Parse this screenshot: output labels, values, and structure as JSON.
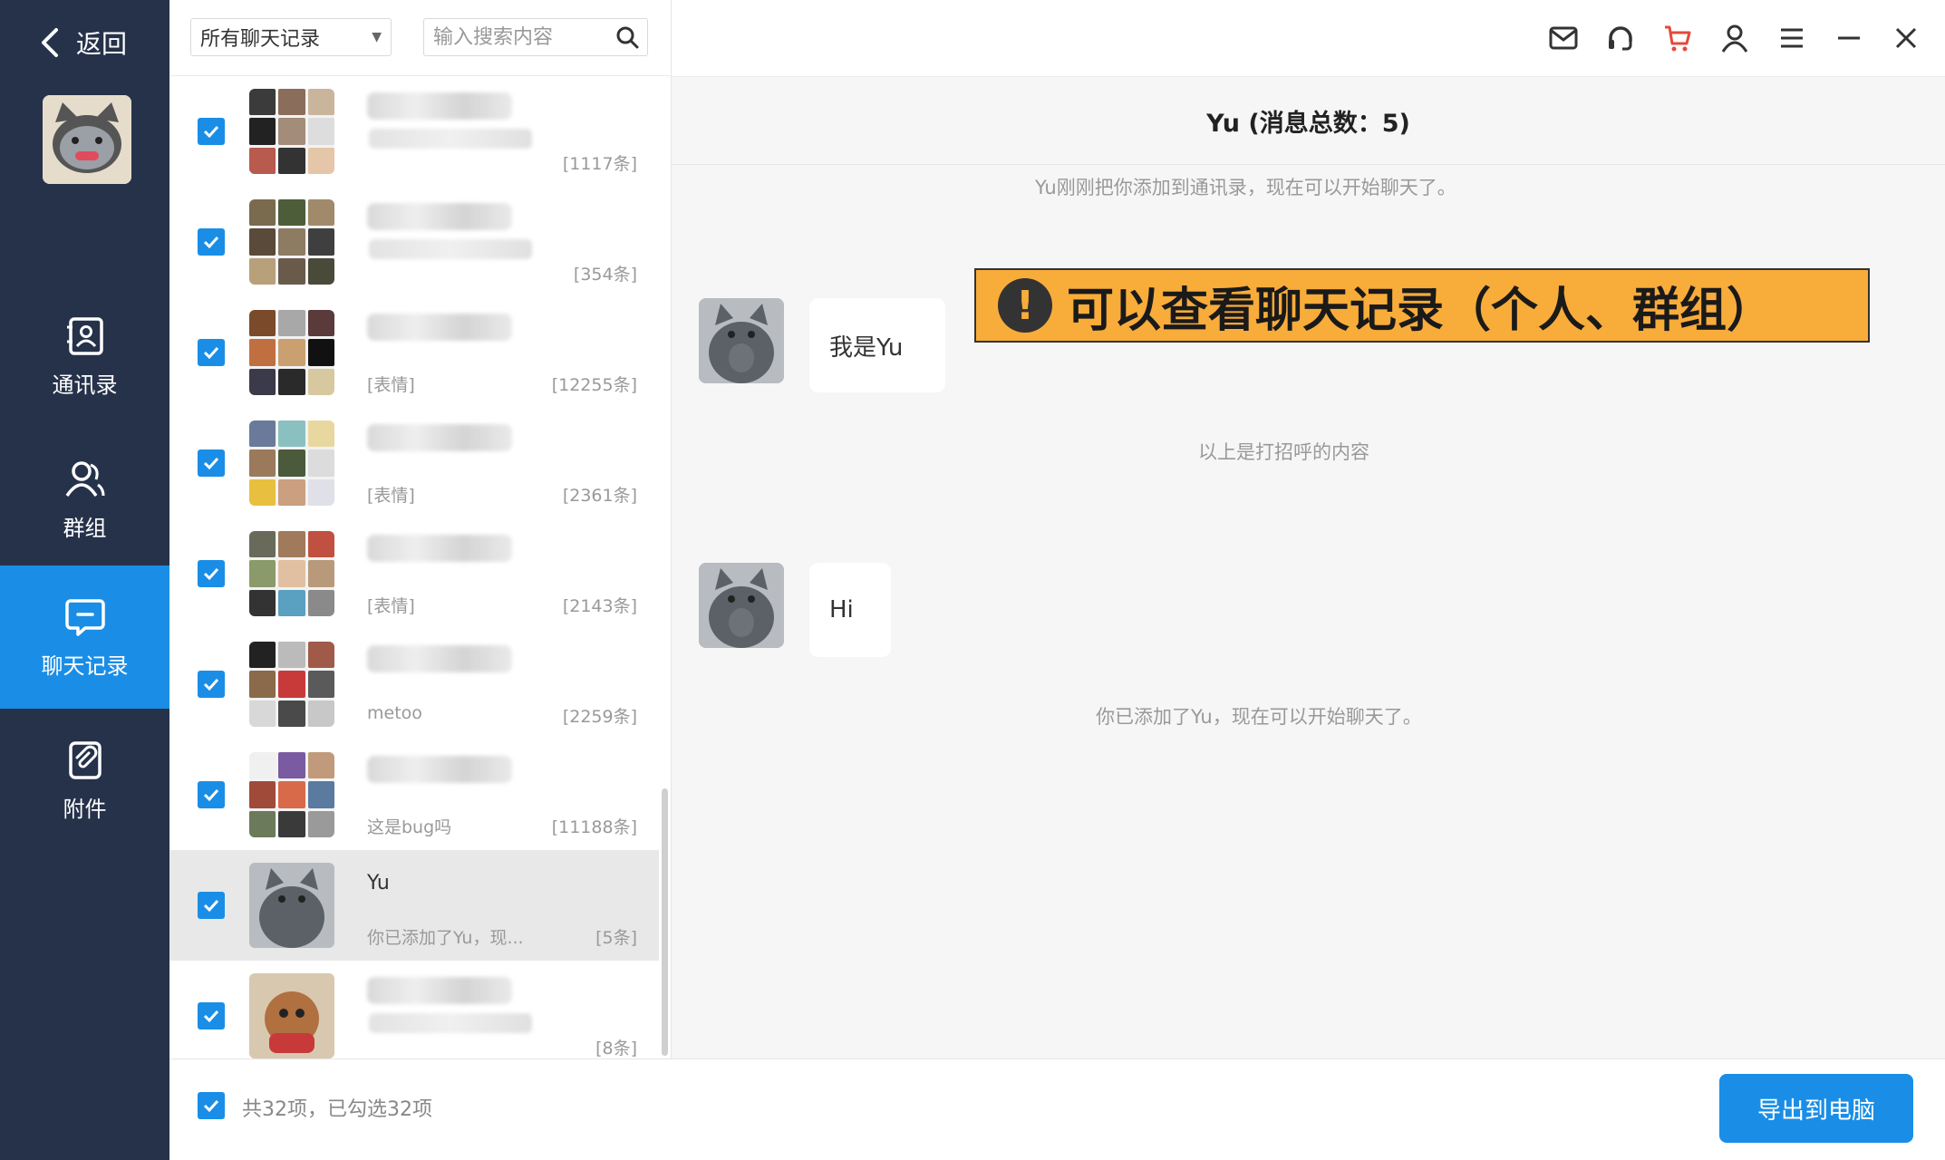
{
  "sidebar": {
    "back_label": "返回",
    "nav": [
      {
        "label": "通讯录",
        "icon": "contacts-icon",
        "active": false
      },
      {
        "label": "群组",
        "icon": "group-icon",
        "active": false
      },
      {
        "label": "聊天记录",
        "icon": "chat-record-icon",
        "active": true
      },
      {
        "label": "附件",
        "icon": "attachment-icon",
        "active": false
      }
    ]
  },
  "list": {
    "filter_value": "所有聊天记录",
    "search_placeholder": "输入搜索内容",
    "conversations": [
      {
        "name": "",
        "preview": "",
        "count": "[1117条]",
        "checked": true,
        "selected": false
      },
      {
        "name": "",
        "preview": "",
        "count": "[354条]",
        "checked": true,
        "selected": false
      },
      {
        "name": "",
        "preview": "[表情]",
        "count": "[12255条]",
        "checked": true,
        "selected": false
      },
      {
        "name": "",
        "preview": "[表情]",
        "count": "[2361条]",
        "checked": true,
        "selected": false
      },
      {
        "name": "",
        "preview": "[表情]",
        "count": "[2143条]",
        "checked": true,
        "selected": false
      },
      {
        "name": "",
        "preview": "metoo",
        "count": "[2259条]",
        "checked": true,
        "selected": false
      },
      {
        "name": "",
        "preview": "这是bug吗",
        "count": "[11188条]",
        "checked": true,
        "selected": false
      },
      {
        "name": "Yu",
        "preview": "你已添加了Yu，现...",
        "count": "[5条]",
        "checked": true,
        "selected": true
      },
      {
        "name": "",
        "preview": "",
        "count": "[8条]",
        "checked": true,
        "selected": false
      }
    ]
  },
  "footer": {
    "status": "共32项，已勾选32项",
    "export_label": "导出到电脑"
  },
  "toolbar": {
    "icons": [
      "mail-icon",
      "headset-icon",
      "cart-icon",
      "user-icon",
      "menu-icon",
      "minimize-icon",
      "close-icon"
    ]
  },
  "chat": {
    "title": "Yu (消息总数：5)",
    "system_1": "Yu刚刚把你添加到通讯录，现在可以开始聊天了。",
    "msg_1": "我是Yu",
    "system_2": "以上是打招呼的内容",
    "msg_2": "Hi",
    "system_3": "你已添加了Yu，现在可以开始聊天了。"
  },
  "banner": {
    "text": "可以查看聊天记录（个人、群组）",
    "mark": "!"
  },
  "colors": {
    "sidebar_bg": "#26324a",
    "accent": "#1a8ee6",
    "banner_bg": "#f8ac3a",
    "chat_bg": "#f6f6f6"
  }
}
